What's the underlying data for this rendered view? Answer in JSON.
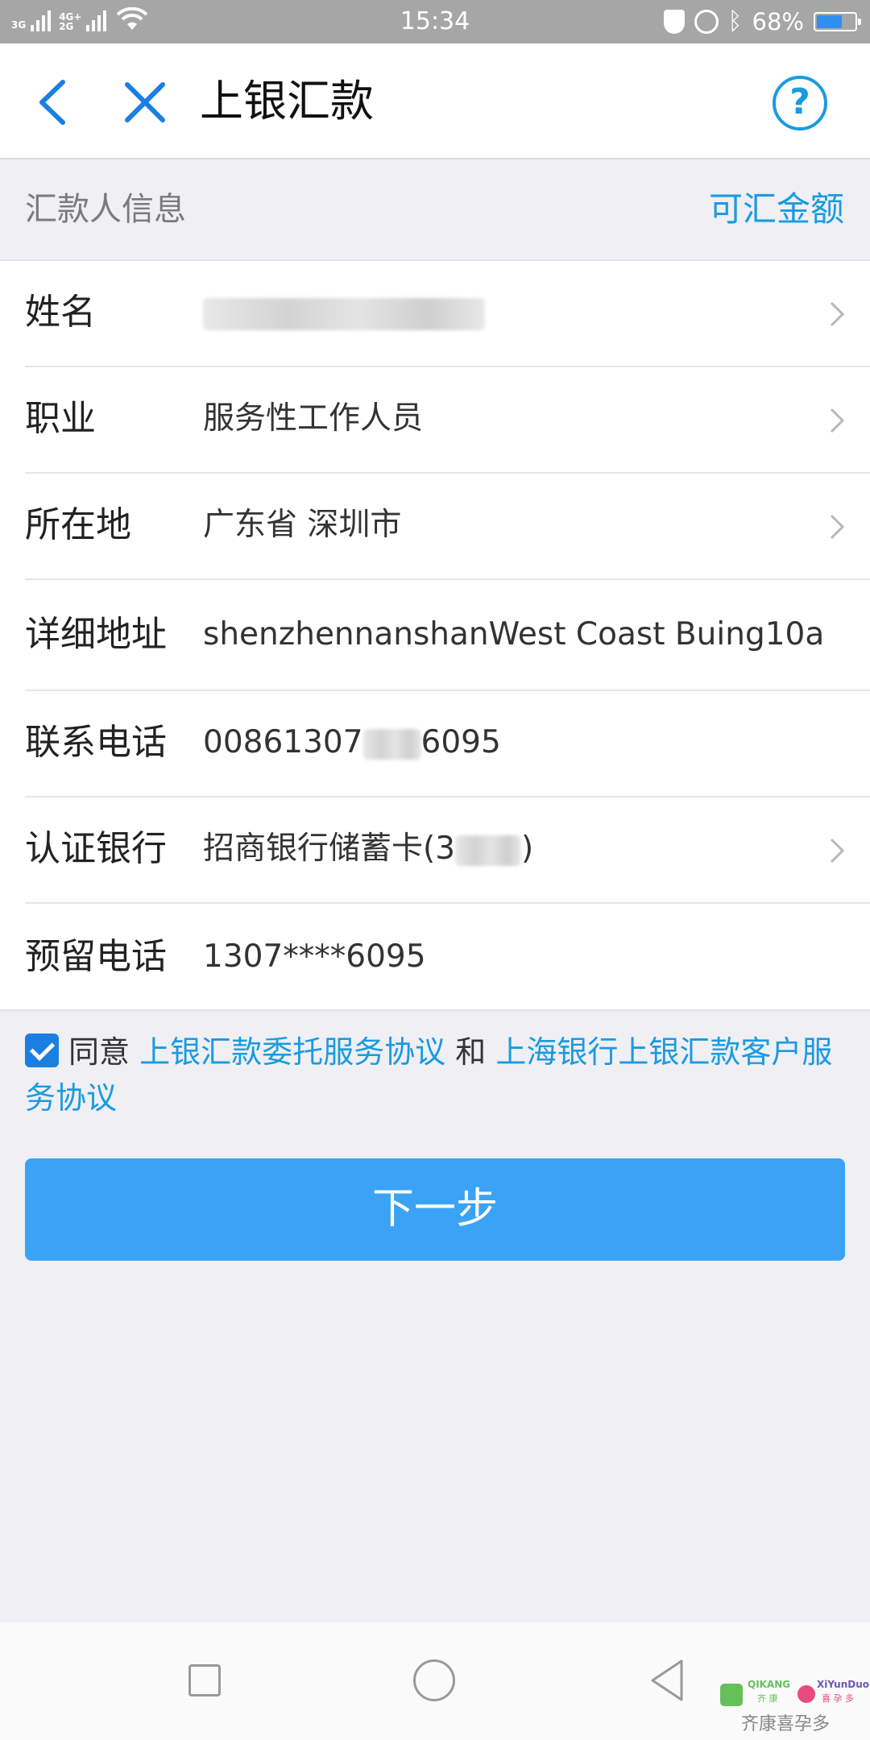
{
  "status_bar": {
    "network_1": "3G",
    "network_2": "4G+",
    "network_3": "2G",
    "time": "15:34",
    "battery": "68%",
    "battery_level": 0.68,
    "icons": [
      "signal-icon",
      "wifi-icon",
      "shield-icon",
      "lock-rotation-icon",
      "bluetooth-icon",
      "battery-icon"
    ]
  },
  "nav": {
    "title": "上银汇款",
    "help_symbol": "?",
    "icons": [
      "back-icon",
      "close-icon",
      "help-icon"
    ]
  },
  "section": {
    "title": "汇款人信息",
    "action": "可汇金额"
  },
  "form": {
    "rows": [
      {
        "label": "姓名",
        "value": "",
        "has_chevron": true
      },
      {
        "label": "职业",
        "value": "服务性工作人员",
        "has_chevron": true
      },
      {
        "label": "所在地",
        "value": "广东省 深圳市",
        "has_chevron": true
      },
      {
        "label": "详细地址",
        "value": "shenzhennanshanWest Coast Buing10a",
        "has_chevron": false
      },
      {
        "label": "联系电话",
        "value_prefix": "00861307",
        "value_suffix": "6095",
        "has_chevron": false
      },
      {
        "label": "认证银行",
        "value_prefix": "招商银行储蓄卡(3",
        "value_suffix": ")",
        "has_chevron": true
      },
      {
        "label": "预留电话",
        "value": "1307****6095",
        "has_chevron": false
      }
    ]
  },
  "agreement": {
    "checked": true,
    "prefix": "同意",
    "link1": "上银汇款委托服务协议",
    "conjunction": "和",
    "link2": "上海银行上银汇款客户服务协议"
  },
  "next_button": {
    "label": "下一步"
  },
  "watermark": {
    "brand1": "QIKANG",
    "brand1_cn": "齐 康",
    "brand2": "XiYunDuo",
    "brand2_cn": "喜 孕 多",
    "caption": "齐康喜孕多"
  },
  "colors": {
    "accent": "#1a9be0",
    "button": "#3aa3f5",
    "status_bar": "#a6a6a6",
    "background": "#efeff4"
  }
}
